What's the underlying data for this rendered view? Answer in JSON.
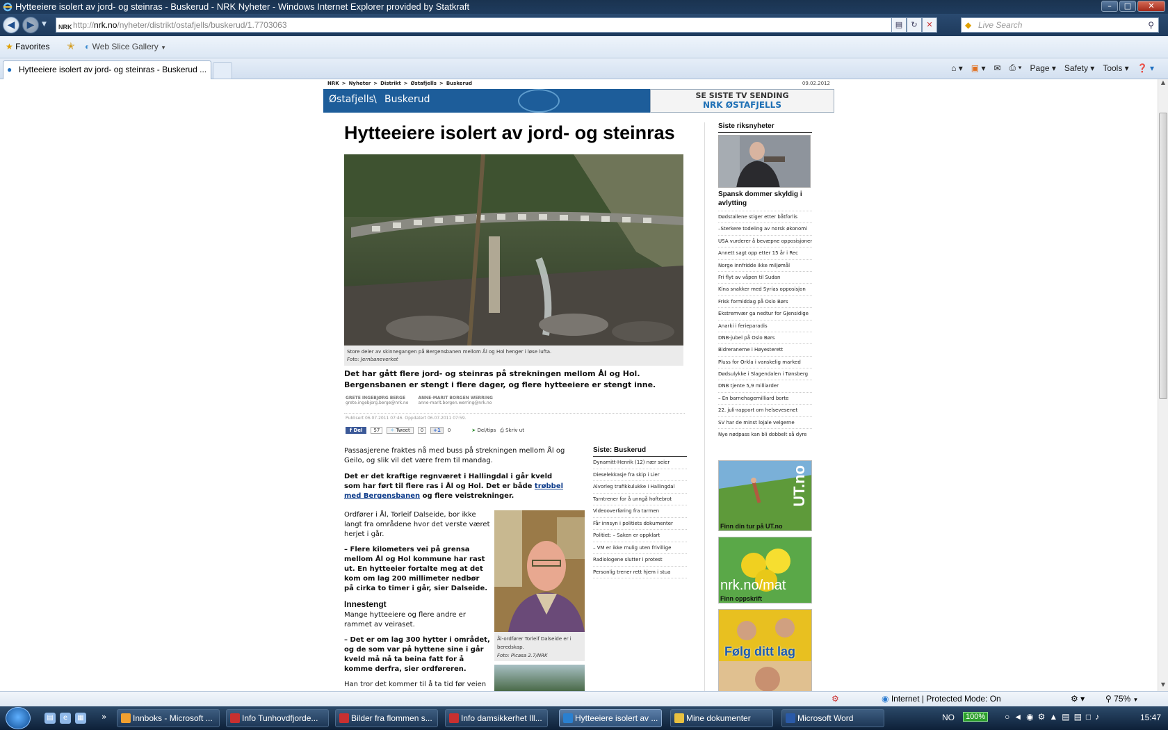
{
  "window": {
    "title": "Hytteeiere isolert av jord- og steinras - Buskerud - NRK Nyheter - Windows Internet Explorer provided by Statkraft"
  },
  "addressbar": {
    "url_prefix": "http://",
    "url_domain": "nrk.no",
    "url_path": "/nyheter/distrikt/ostafjells/buskerud/1.7703063",
    "site_badge": "NRK"
  },
  "searchbox": {
    "placeholder": "Live Search"
  },
  "favorites_bar": {
    "favorites_label": "Favorites",
    "web_slice_label": "Web Slice Gallery"
  },
  "tabs": [
    {
      "label": "Hytteeiere isolert av jord- og steinras - Buskerud ..."
    }
  ],
  "commandbar": {
    "page": "Page",
    "safety": "Safety",
    "tools": "Tools"
  },
  "statusbar": {
    "zone": "Internet | Protected Mode: On",
    "zoom": "75%"
  },
  "taskbar": {
    "items": [
      {
        "label": "Innboks - Microsoft ...",
        "color": "#f0a030"
      },
      {
        "label": "Info Tunhovdfjorde...",
        "color": "#c83030"
      },
      {
        "label": "Bilder fra flommen s...",
        "color": "#c83030"
      },
      {
        "label": "Info damsikkerhet Ill...",
        "color": "#c83030"
      },
      {
        "label": "Hytteeiere isolert av ...",
        "color": "#2a80d0"
      },
      {
        "label": "Mine dokumenter",
        "color": "#e8c040"
      },
      {
        "label": "Microsoft Word",
        "color": "#2a5aa8"
      }
    ],
    "lang": "NO",
    "battery": "100%",
    "clock": "15:47"
  },
  "page": {
    "breadcrumbs": [
      "NRK",
      ">",
      "Nyheter",
      ">",
      "Distrikt",
      ">",
      "Østafjells",
      ">",
      "Buskerud"
    ],
    "date": "09.02.2012",
    "header": {
      "region": "Østafjells",
      "sub": "Buskerud"
    },
    "tv_ad": {
      "line1": "SE SISTE TV SENDING",
      "line2": "NRK ØSTAFJELLS"
    },
    "article": {
      "title": "Hytteeiere isolert av jord- og steinras",
      "image_caption": "Store deler av skinnegangen på Bergensbanen mellom Ål og Hol henger i løse lufta.",
      "image_credit": "Foto: Jernbaneverket",
      "ingress": "Det har gått flere jord- og steinras på strekningen mellom Ål og Hol. Bergensbanen er stengt i flere dager, og flere hytteeiere er stengt inne.",
      "bylines": [
        {
          "name": "GRETE INGEBJØRG BERGE",
          "email": "grete.ingebjorg.berge@nrk.no"
        },
        {
          "name": "ANNE-MARIT BORGEN WERRING",
          "email": "anne-marit.borgen.werring@nrk.no"
        }
      ],
      "published": "Publisert 06.07.2011 07:46. Oppdatert 06.07.2011 07:59.",
      "share": {
        "fb": "Del",
        "fb_count": "57",
        "tweet": "Tweet",
        "tweet_count": "0",
        "gplus": "+1",
        "gplus_count": "0",
        "tips": "Del/tips",
        "print": "Skriv ut"
      },
      "p1": "Passasjerene fraktes nå med buss på strekningen mellom Ål og Geilo, og slik vil det være frem til mandag.",
      "p2_a": "Det er det kraftige regnværet i Hallingdal i går kveld som har ført til flere ras i Ål og Hol. Det er både ",
      "p2_link": "trøbbel med Bergensbanen",
      "p2_b": " og flere veistrekninger.",
      "p3": "Ordfører i Ål, Torleif Dalseide, bor ikke langt fra områdene hvor det verste været herjet i går.",
      "p4": "– Flere kilometers vei på grensa mellom Ål og Hol kommune har rast ut. En hytteeier fortalte meg at det kom om lag 200 millimeter nedbør på cirka to timer i går, sier Dalseide.",
      "h_innestengt": "Innestengt",
      "p5": "Mange hytteeiere og flere andre er rammet av veiraset.",
      "p6": "– Det er om lag 300 hytter i området, og de som var på hyttene sine i går kveld må nå ta beina fatt for å komme derfra, sier ordføreren.",
      "p7": "Han tror det kommer til å ta tid før veien",
      "portrait_caption": "Ål-ordfører Torleif Dalseide er i beredskap.",
      "portrait_credit": "Foto: Picasa 2.7/NRK"
    },
    "siste_buskerud": {
      "heading": "Siste: Buskerud",
      "items": [
        "Dynamitt-Henrik (12) nær seier",
        "Dieselekkasje fra skip i Lier",
        "Alvorleg trafikkulukke i Hallingdal",
        "Tarntrener for å unngå hoftebrot",
        "Videooverføring fra tarmen",
        "Får innsyn i politiets dokumenter",
        "Politiet: – Saken er oppklart",
        "– VM er ikke mulig uten frivillige",
        "Radiologene slutter i protest",
        "Personlig trener rett hjem i stua"
      ]
    },
    "sidebar": {
      "heading": "Siste riksnyheter",
      "top_headline": "Spansk dommer skyldig i avlytting",
      "items": [
        "Dødstallene stiger etter båtforlis",
        "–Sterkere todeling av norsk økonomi",
        "USA vurderer å bevæpne opposisjonen",
        "Annett sagt opp etter 15 år i Rec",
        "Norge innfridde ikke miljømål",
        "Fri flyt av våpen til Sudan",
        "Kina snakker med Syrias opposisjon",
        "Frisk formiddag på Oslo Børs",
        "Ekstremvær ga nedtur for Gjensidige",
        "Anarki i ferieparadis",
        "DNB-jubel på Oslo Børs",
        "Bidreranerne i Høyesterett",
        "Pluss for Orkla i vanskelig marked",
        "Dødsulykke i Slagendalen i Tønsberg",
        "DNB tjente 5,9 milliarder",
        "– En barnehagemilliard borte",
        "22. juli-rapport om helsevesenet",
        "SV har de minst lojale velgerne",
        "Nye nødpass kan bli dobbelt så dyre"
      ],
      "promos": [
        {
          "big": "UT.no",
          "caption": "Finn din tur på UT.no"
        },
        {
          "big": "nrk.no/mat",
          "caption": "Finn oppskrift"
        },
        {
          "big": "Følg ditt lag",
          "caption": ""
        }
      ]
    }
  }
}
